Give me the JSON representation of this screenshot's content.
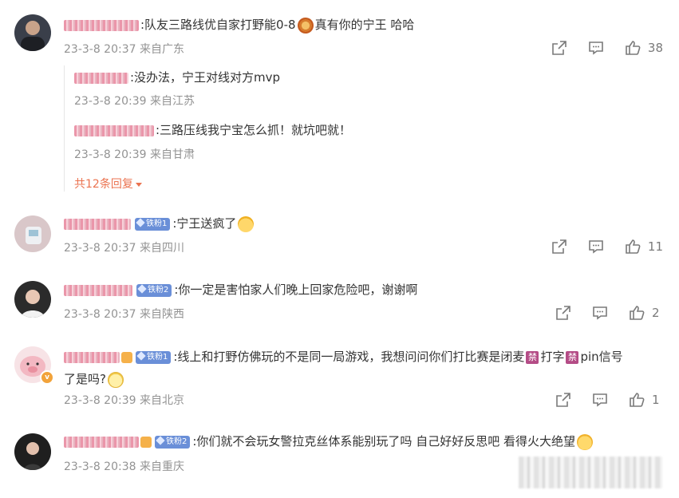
{
  "comments": [
    {
      "text": ":队友三路线优自家打野能0-8",
      "text_after_emoji": "真有你的宁王 哈哈",
      "time": "23-3-8 20:37",
      "location": "来自广东",
      "likes": "38",
      "avatar_color": "#3a3f4a"
    },
    {
      "fan_badge": "铁粉1",
      "text": ":宁王送疯了",
      "time": "23-3-8 20:37",
      "location": "来自四川",
      "likes": "11",
      "avatar_color": "#d9c7c9"
    },
    {
      "fan_badge": "铁粉2",
      "text": ":你一定是害怕家人们晚上回家危险吧，谢谢啊",
      "time": "23-3-8 20:37",
      "location": "来自陕西",
      "likes": "2",
      "avatar_color": "#2b2b2b"
    },
    {
      "fan_badge": "铁粉1",
      "text": ":线上和打野仿佛玩的不是同一局游戏，我想问问你们打比赛是闭麦",
      "ban_glyph": "禁",
      "text_mid": "打字",
      "text_after": "pin信号",
      "text_line2": "了是吗?",
      "time": "23-3-8 20:39",
      "location": "来自北京",
      "likes": "1",
      "verified_glyph": "v",
      "avatar_color": "#f3c6cc"
    },
    {
      "fan_badge": "铁粉2",
      "text": ":你们就不会玩女警拉克丝体系能别玩了吗 自己好好反思吧 看得火大绝望",
      "time": "23-3-8 20:38",
      "location": "来自重庆",
      "avatar_color": "#1f1f1f"
    }
  ],
  "replies": [
    {
      "text": ":没办法，宁王对线对方mvp",
      "time": "23-3-8 20:39",
      "location": "来自江苏"
    },
    {
      "text": ":三路压线我宁宝怎么抓！就坑吧就！",
      "time": "23-3-8 20:39",
      "location": "来自甘肃"
    }
  ],
  "more_replies": "共12条回复",
  "icons": {
    "share": "share-icon",
    "comment": "comment-icon",
    "like": "thumbs-up-icon"
  },
  "accent": "#eb7350"
}
